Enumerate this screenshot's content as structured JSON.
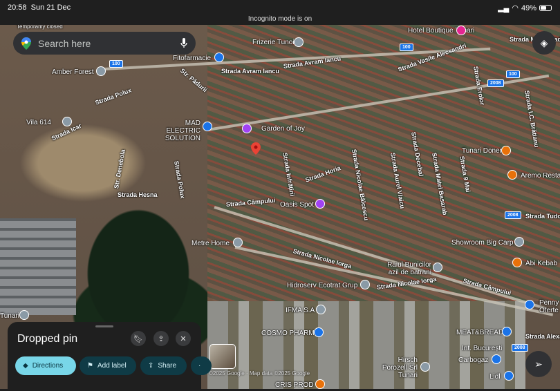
{
  "status_bar": {
    "time": "20:58",
    "date": "Sun 21 Dec",
    "battery": "49%",
    "battery_level": 0.49,
    "incognito": "Incognito mode is on"
  },
  "search": {
    "placeholder": "Search here"
  },
  "map": {
    "places": [
      {
        "name": "Temporarily closed",
        "pin": "grey"
      },
      {
        "name": "Amber Forest",
        "pin": "grey"
      },
      {
        "name": "Fitofarmacie",
        "pin": "blue"
      },
      {
        "name": "Frizerie Tunoi",
        "pin": "grey"
      },
      {
        "name": "Hotel Boutique Tunari",
        "pin": "pink"
      },
      {
        "name": "Vila 614",
        "pin": "grey"
      },
      {
        "name": "MAD ELECTRIC SOLUTION",
        "pin": "blue"
      },
      {
        "name": "Garden of Joy",
        "pin": "purple"
      },
      {
        "name": "Oasis Spot",
        "pin": "purple"
      },
      {
        "name": "Metre Home",
        "pin": "grey"
      },
      {
        "name": "Tunari Doner",
        "pin": "orange"
      },
      {
        "name": "Aremo Resta",
        "pin": "orange"
      },
      {
        "name": "Showroom Big Carp",
        "pin": "grey"
      },
      {
        "name": "Abi Kebab",
        "pin": "orange"
      },
      {
        "name": "Raiul Bunicilor azil de batrani",
        "pin": "grey"
      },
      {
        "name": "Hidroserv Ecotrat Grup",
        "pin": "grey"
      },
      {
        "name": "IFMA S.A",
        "pin": "grey"
      },
      {
        "name": "COSMO PHARM",
        "pin": "blue"
      },
      {
        "name": "Penny Oferte",
        "pin": "blue"
      },
      {
        "name": "MEAT&BREAD",
        "pin": "blue"
      },
      {
        "name": "Int. București",
        "pin": "none"
      },
      {
        "name": "Carbogaz",
        "pin": "blue"
      },
      {
        "name": "Hirsch Porozell Srl Tunari",
        "pin": "grey"
      },
      {
        "name": "Lidl",
        "pin": "blue"
      },
      {
        "name": "CRIS PROD",
        "pin": "orange"
      },
      {
        "name": "Tunari",
        "pin": "grey"
      }
    ],
    "streets": [
      "Strada Avram Iancu",
      "Strada Avram Iancu",
      "Str. Pădurii",
      "Strada Vasile Alecsandri",
      "Strada Mihail Sadoveanu",
      "Strada Polux",
      "Strada Icar",
      "Str. Denebola",
      "Strada Hesna",
      "Strada Polux",
      "Strada Câmpului",
      "Strada Horia",
      "Strada Nicolae Bălcescu",
      "Strada Aurel Vlaicu",
      "Strada Decebal",
      "Strada Matei Basarab",
      "Strada 9 Mai",
      "Strada Erolor",
      "Strada I.C. Brătianu",
      "Strada Nicolae Iorga",
      "Strada Nicolae Iorga",
      "Strada Câmpului",
      "Strada Tudor",
      "Strada Alexa",
      "Strada Infrățirii"
    ],
    "road_shields": [
      "100",
      "100",
      "2008",
      "100",
      "2008",
      "2008"
    ],
    "copyright": "©2025 Google · Map data ©2025 Google"
  },
  "sheet": {
    "title": "Dropped pin",
    "actions": {
      "directions": "Directions",
      "add_label": "Add label",
      "share": "Share"
    }
  },
  "colors": {
    "accent": "#78d6e8",
    "pin": "#ea4335"
  }
}
